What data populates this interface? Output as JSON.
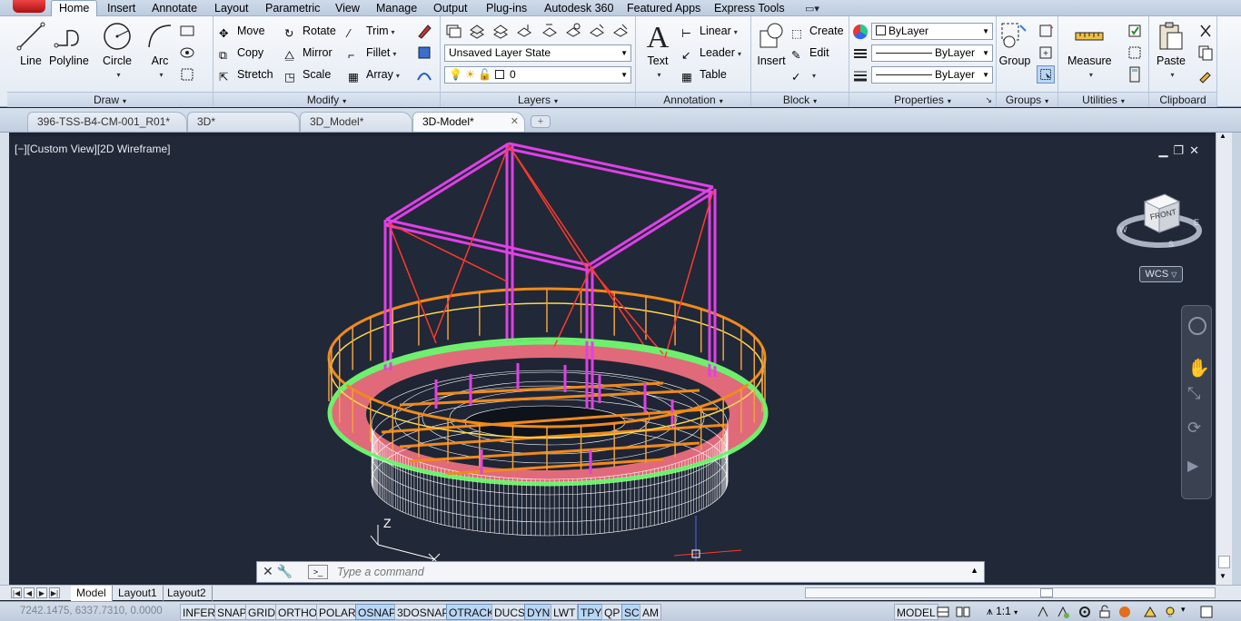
{
  "ribbon_tabs": [
    "Home",
    "Insert",
    "Annotate",
    "Layout",
    "Parametric",
    "View",
    "Manage",
    "Output",
    "Plug-ins",
    "Autodesk 360",
    "Featured Apps",
    "Express Tools"
  ],
  "draw": {
    "title": "Draw",
    "line": "Line",
    "polyline": "Polyline",
    "circle": "Circle",
    "arc": "Arc"
  },
  "modify": {
    "title": "Modify",
    "move": "Move",
    "rotate": "Rotate",
    "trim": "Trim",
    "copy": "Copy",
    "mirror": "Mirror",
    "fillet": "Fillet",
    "stretch": "Stretch",
    "scale": "Scale",
    "array": "Array"
  },
  "layers": {
    "title": "Layers",
    "layer_state": "Unsaved Layer State",
    "current_layer": "0"
  },
  "annotation": {
    "title": "Annotation",
    "text": "Text",
    "linear": "Linear",
    "leader": "Leader",
    "table": "Table"
  },
  "block": {
    "title": "Block",
    "insert": "Insert",
    "create": "Create",
    "edit": "Edit"
  },
  "properties": {
    "title": "Properties",
    "color": "ByLayer",
    "linetype": "ByLayer",
    "lineweight": "ByLayer"
  },
  "groups": {
    "title": "Groups",
    "group": "Group"
  },
  "utilities": {
    "title": "Utilities",
    "measure": "Measure"
  },
  "clipboard": {
    "title": "Clipboard",
    "paste": "Paste"
  },
  "file_tabs": [
    "396-TSS-B4-CM-001_R01*",
    "3D*",
    "3D_Model*",
    "3D-Model*"
  ],
  "active_file_tab": "3D-Model*",
  "viewport": {
    "label": "[−][Custom View][2D Wireframe]",
    "viewcube_face": "FRONT",
    "wcs": "WCS",
    "ucs_axis_z": "Z"
  },
  "command_line": {
    "placeholder": "Type a command"
  },
  "layout_tabs": [
    "Model",
    "Layout1",
    "Layout2"
  ],
  "status": {
    "coords": "7242.1475, 6337.7310, 0.0000",
    "toggles": [
      "INFER",
      "SNAP",
      "GRID",
      "ORTHO",
      "POLAR",
      "OSNAP",
      "3DOSNAP",
      "OTRACK",
      "DUCS",
      "DYN",
      "LWT",
      "TPY",
      "QP",
      "SC",
      "AM"
    ],
    "toggles_on": [
      "OSNAP",
      "OTRACK",
      "DYN",
      "TPY",
      "SC"
    ],
    "space": "MODEL",
    "annotation_scale": "1:1"
  },
  "colors": {
    "viewport_bg": "#212838",
    "magenta": "#e040e8",
    "orange": "#f08a1a",
    "green": "#6ef06e",
    "pink": "#f07a8a",
    "red": "#ff3a2a",
    "white": "#ffffff"
  }
}
